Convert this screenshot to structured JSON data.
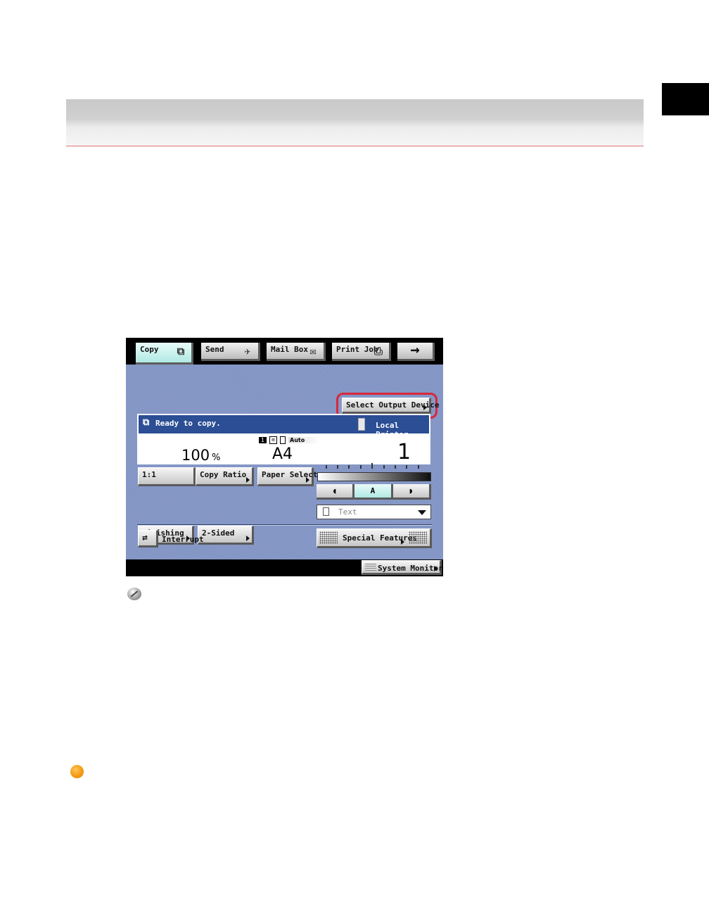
{
  "tabs": [
    {
      "label": "Copy",
      "icon": "copy-icon",
      "active": true
    },
    {
      "label": "Send",
      "icon": "send-icon",
      "active": false
    },
    {
      "label": "Mail Box",
      "icon": "mailbox-icon",
      "active": false
    },
    {
      "label": "Print Job",
      "icon": "printer-job-icon",
      "active": false
    },
    {
      "label": "→",
      "icon": "arrow-right-icon",
      "active": false
    }
  ],
  "select_output_device": "Select Output Device",
  "status": {
    "message": "Ready to copy.",
    "output_device": "Local Printer",
    "ratio_value": "100",
    "ratio_unit": "%",
    "paper_size": "A4",
    "copies": "1",
    "mini_number": "1",
    "mini_auto": "Auto"
  },
  "buttons": {
    "one_to_one": "1:1",
    "copy_ratio": "Copy Ratio",
    "paper_select": "Paper Select",
    "finishing": "Finishing",
    "two_sided": "2-Sided",
    "interrupt": "Interrupt",
    "special_features": "Special Features",
    "system_monitor": "System Monitor"
  },
  "density": {
    "lighter": "◖",
    "auto": "A",
    "darker": "◗",
    "selected": "auto"
  },
  "original_type": "Text",
  "colors": {
    "screen_body": "#8294c4",
    "status_bar": "#2b4e94",
    "active_tab": "#b0e9e3",
    "highlight": "#d8283c",
    "note_dot": "#f39a10"
  }
}
